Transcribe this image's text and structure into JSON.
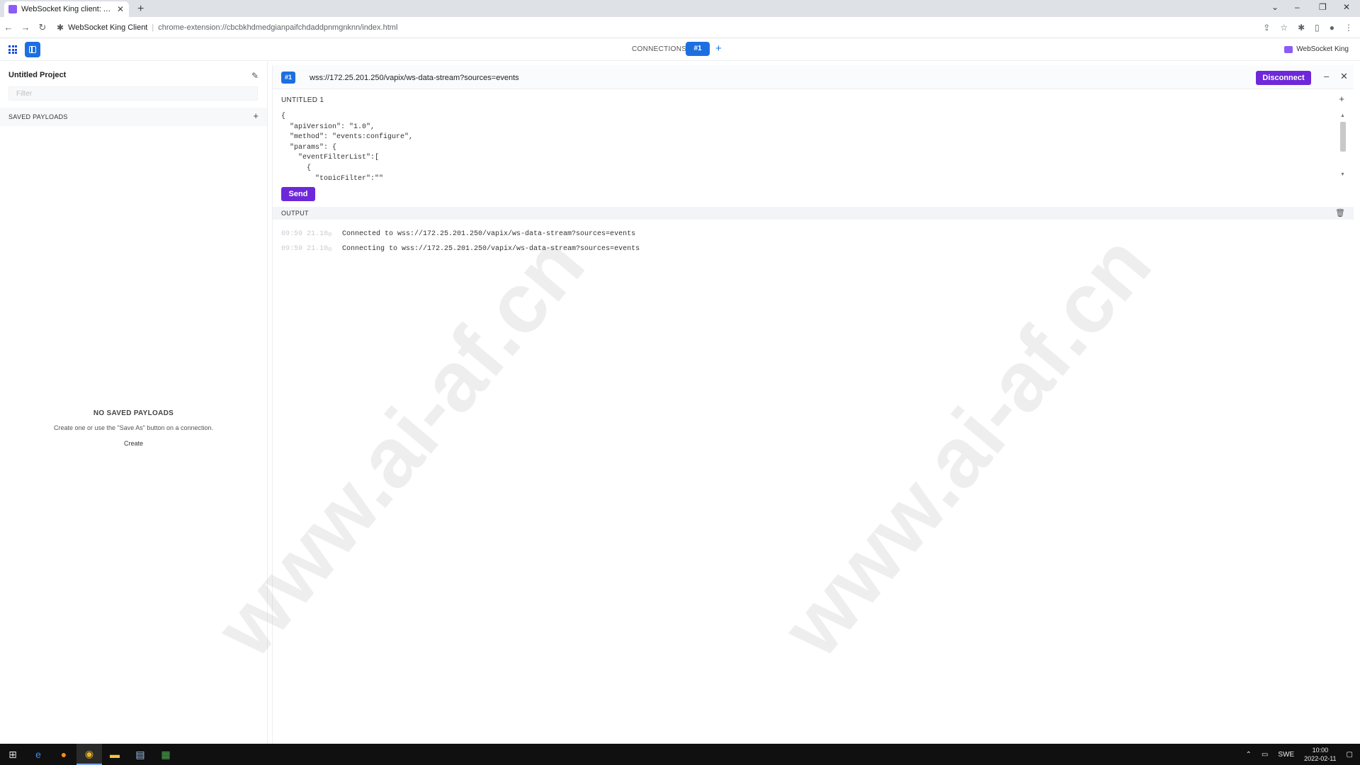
{
  "browser": {
    "tab_title": "WebSocket King client: A testing",
    "tab_close": "✕",
    "new_tab": "+",
    "site_name": "WebSocket King Client",
    "url": "chrome-extension://cbcbkhdmedgianpaifchdaddpnmgnknn/index.html"
  },
  "header": {
    "connections_label": "CONNECTIONS",
    "active_connection": "#1",
    "add_connection": "+",
    "brand": "WebSocket King"
  },
  "sidebar": {
    "project_title": "Untitled Project",
    "filter_placeholder": "Filter",
    "saved_payloads_label": "SAVED PAYLOADS",
    "add_payload": "+",
    "empty_title": "NO SAVED PAYLOADS",
    "empty_desc": "Create one or use the \"Save As\" button on a connection.",
    "empty_create": "Create"
  },
  "connection": {
    "badge": "#1",
    "url": "wss://172.25.201.250/vapix/ws-data-stream?sources=events",
    "disconnect_label": "Disconnect",
    "minimize": "–",
    "close": "✕"
  },
  "payload": {
    "name": "UNTITLED 1",
    "add": "+",
    "code": "{\n  \"apiVersion\": \"1.0\",\n  \"method\": \"events:configure\",\n  \"params\": {\n    \"eventFilterList\":[\n      {\n        \"topicFilter\":\"\"",
    "send_label": "Send"
  },
  "output": {
    "label": "OUTPUT",
    "rows": [
      {
        "time": "09:59 21.18",
        "message": "Connected to wss://172.25.201.250/vapix/ws-data-stream?sources=events"
      },
      {
        "time": "09:59 21.10",
        "message": "Connecting to wss://172.25.201.250/vapix/ws-data-stream?sources=events"
      }
    ]
  },
  "taskbar": {
    "language": "SWE",
    "time": "10:00",
    "date": "2022-02-11"
  },
  "watermark": "www.ai-af.cn",
  "colors": {
    "accent_blue": "#1d6fe0",
    "accent_purple": "#6d28d9"
  }
}
